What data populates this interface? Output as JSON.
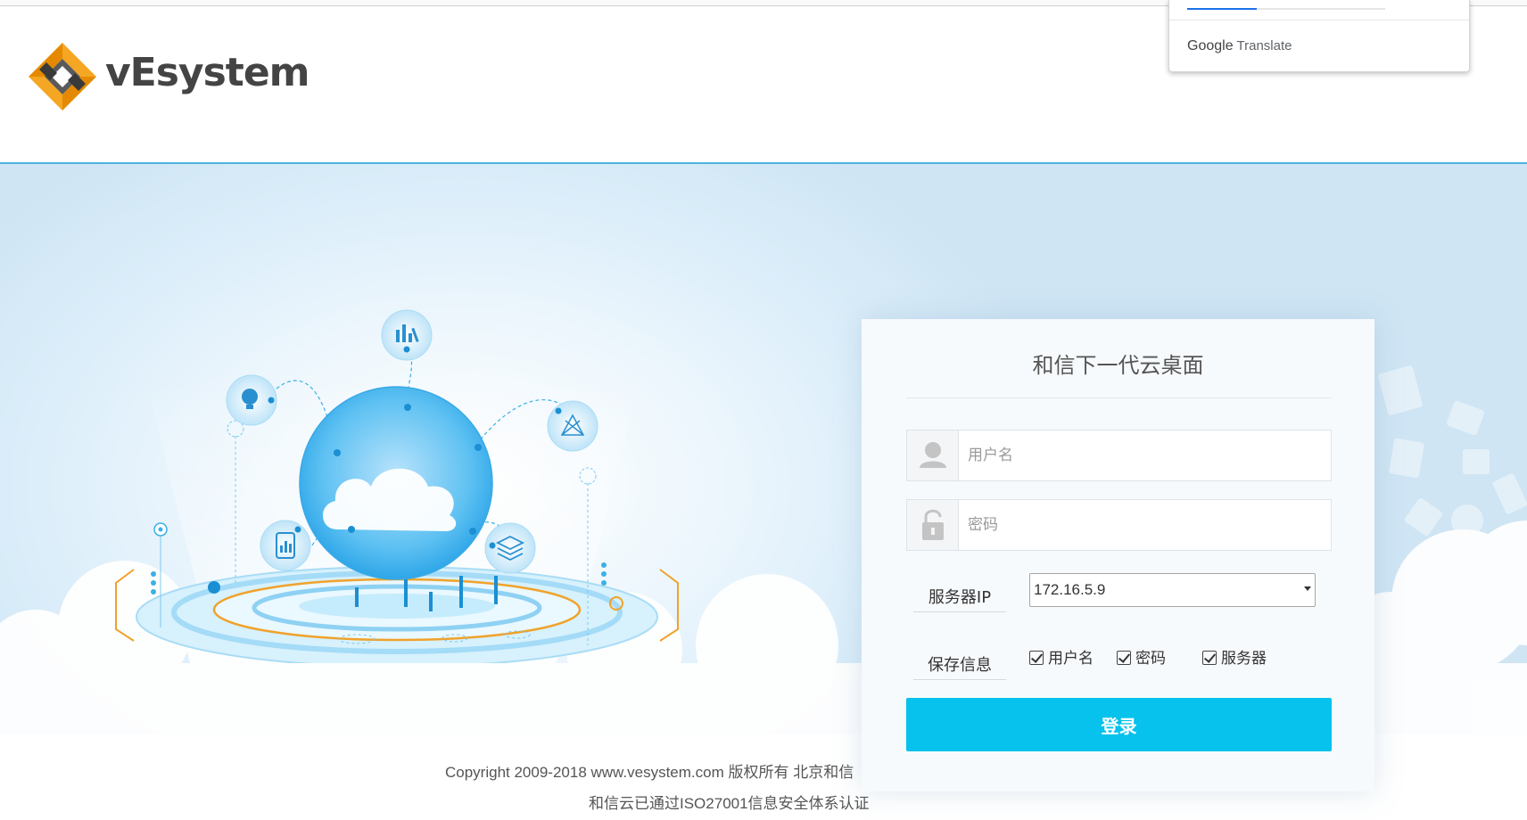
{
  "header": {
    "brand_name": "vEsystem",
    "brand_colors": {
      "orange": "#f39c12",
      "gray": "#5a5a5a",
      "dark": "#3a3a3a"
    }
  },
  "translate_popup": {
    "brand_google": "Google",
    "brand_translate": "Translate",
    "progress": 0.35,
    "accent": "#1a73e8"
  },
  "banner": {
    "illustration_icons": [
      "bar-chart-icon",
      "lightbulb-icon",
      "network-icon",
      "mobile-chart-icon",
      "layers-icon",
      "cloud-icon"
    ]
  },
  "login": {
    "title": "和信下一代云桌面",
    "username_placeholder": "用户名",
    "password_placeholder": "密码",
    "server_label": "服务器IP",
    "server_value": "172.16.5.9",
    "save_label": "保存信息",
    "save_options": [
      {
        "label": "用户名",
        "checked": true
      },
      {
        "label": "密码",
        "checked": true
      },
      {
        "label": "服务器",
        "checked": true
      }
    ],
    "submit_label": "登录",
    "accent": "#06c2ec"
  },
  "footer": {
    "copyright_line1": "Copyright 2009-2018 www.vesystem.com 版权所有 北京和信",
    "copyright_line2": "和信云已通过ISO27001信息安全体系认证"
  }
}
